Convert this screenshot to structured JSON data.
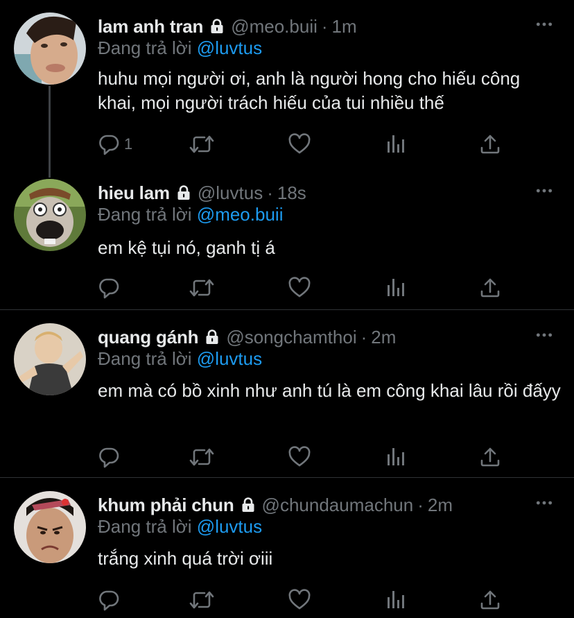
{
  "colors": {
    "background": "#000000",
    "text": "#e7e9ea",
    "muted": "#71767b",
    "link": "#1d9bf0",
    "divider": "#2f3336"
  },
  "icons": {
    "lock": "lock-icon",
    "more": "more-dots-icon",
    "reply": "reply-icon",
    "retweet": "retweet-icon",
    "like": "heart-icon",
    "analytics": "analytics-icon",
    "share": "share-icon"
  },
  "tweets": [
    {
      "name": "lam anh tran",
      "handle": "@meo.buii",
      "separator": "·",
      "time": "1m",
      "reply_prefix": "Đang trả lời",
      "reply_to": "@luvtus",
      "text": "huhu mọi người ơi, anh là người hong cho hiếu công khai, mọi người trách hiếu của tui nhiều thế",
      "reply_count": "1"
    },
    {
      "name": "hieu lam",
      "handle": "@luvtus",
      "separator": "·",
      "time": "18s",
      "reply_prefix": "Đang trả lời",
      "reply_to": "@meo.buii",
      "text": "em kệ tụi nó, ganh tị á",
      "reply_count": ""
    },
    {
      "name": "quang gánh",
      "handle": "@songchamthoi",
      "separator": "·",
      "time": "2m",
      "reply_prefix": "Đang trả lời",
      "reply_to": "@luvtus",
      "text": "em mà có bồ xinh như anh tú là em công khai lâu rồi đấyy",
      "reply_count": ""
    },
    {
      "name": "khum phải chun",
      "handle": "@chundaumachun",
      "separator": "·",
      "time": "2m",
      "reply_prefix": "Đang trả lời",
      "reply_to": "@luvtus",
      "text": "trắng xinh quá trời ơiii",
      "reply_count": ""
    }
  ]
}
